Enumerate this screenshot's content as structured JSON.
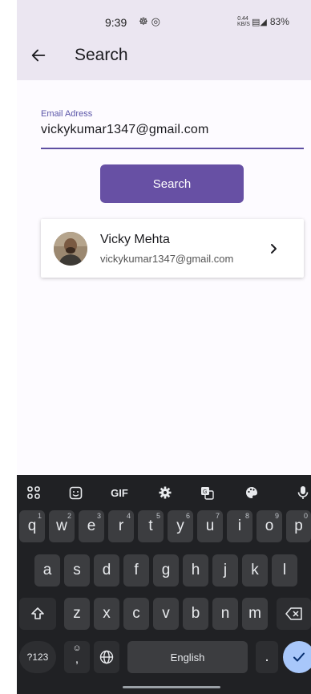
{
  "status_bar": {
    "time": "9:39",
    "left_icons": [
      "notification-icon",
      "instagram-icon"
    ],
    "net_speed_value": "0.44",
    "net_speed_unit": "KB/S",
    "battery": "83%"
  },
  "app_bar": {
    "title": "Search"
  },
  "form": {
    "email_label": "Email Adress",
    "email_value": "vickykumar1347@gmail.com",
    "search_button": "Search"
  },
  "result": {
    "name": "Vicky Mehta",
    "email": "vickykumar1347@gmail.com"
  },
  "keyboard": {
    "toolbar": [
      "apps-icon",
      "sticker-icon",
      "GIF",
      "settings-icon",
      "translate-icon",
      "palette-icon",
      "mic-icon"
    ],
    "gif_label": "GIF",
    "row1": [
      {
        "k": "q",
        "h": "1"
      },
      {
        "k": "w",
        "h": "2"
      },
      {
        "k": "e",
        "h": "3"
      },
      {
        "k": "r",
        "h": "4"
      },
      {
        "k": "t",
        "h": "5"
      },
      {
        "k": "y",
        "h": "6"
      },
      {
        "k": "u",
        "h": "7"
      },
      {
        "k": "i",
        "h": "8"
      },
      {
        "k": "o",
        "h": "9"
      },
      {
        "k": "p",
        "h": "0"
      }
    ],
    "row2": [
      "a",
      "s",
      "d",
      "f",
      "g",
      "h",
      "j",
      "k",
      "l"
    ],
    "row3": [
      "z",
      "x",
      "c",
      "v",
      "b",
      "n",
      "m"
    ],
    "symbols_key": "?123",
    "comma_key": ",",
    "space_label": "English",
    "period_key": "."
  }
}
